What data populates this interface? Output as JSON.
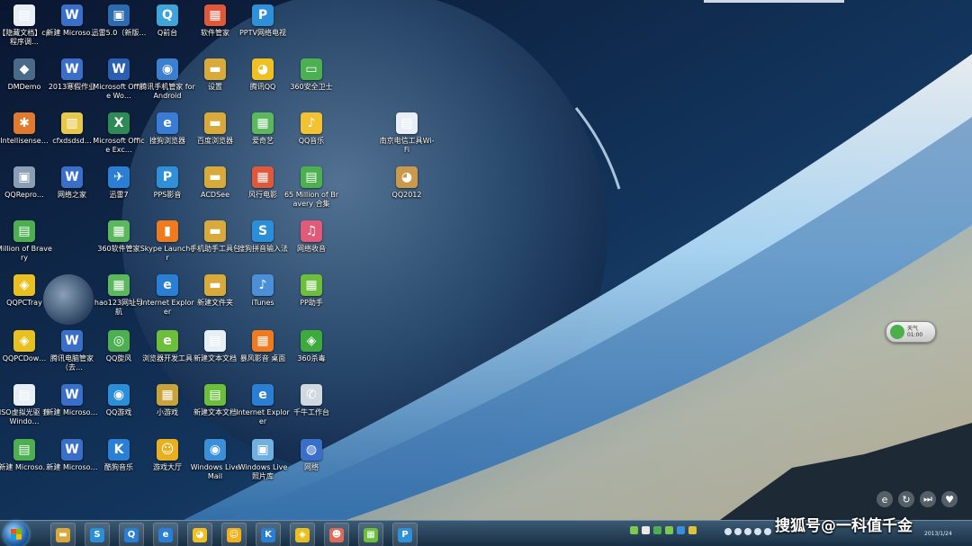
{
  "colors": {
    "taskbar": "#1f3a52",
    "label_text": "#ffffff"
  },
  "desktop": {
    "icons": [
      {
        "label": "【隐藏文档】cp程序调…",
        "icon": "document-icon",
        "color": "#e8eef5",
        "glyph": "▤"
      },
      {
        "label": "新建 Microso…",
        "icon": "document-icon",
        "color": "#3a6fc9",
        "glyph": "W"
      },
      {
        "label": "迅雷5.0（新版…",
        "icon": "browser-window-icon",
        "color": "#2b6cb0",
        "glyph": "▣"
      },
      {
        "label": "Q前台",
        "icon": "shortcut-icon",
        "color": "#3da5d9",
        "glyph": "Q"
      },
      {
        "label": "软件管家",
        "icon": "app-icon",
        "color": "#e0583a",
        "glyph": "▦"
      },
      {
        "label": "PPTV网络电视",
        "icon": "pptv-icon",
        "color": "#2f8fd8",
        "glyph": "P"
      },
      {
        "label": "DMDemo",
        "icon": "app-icon",
        "color": "#4a6a8a",
        "glyph": "◆"
      },
      {
        "label": "2013寒假作业",
        "icon": "document-icon",
        "color": "#3a6fc9",
        "glyph": "W"
      },
      {
        "label": "Microsoft Office Wo…",
        "icon": "word-icon",
        "color": "#2b5fb3",
        "glyph": "W"
      },
      {
        "label": "腾讯手机管家 for Android",
        "icon": "phone-manager-icon",
        "color": "#3b7fd0",
        "glyph": "◉"
      },
      {
        "label": "设置",
        "icon": "folder-icon",
        "color": "#d9a93a",
        "glyph": "▬"
      },
      {
        "label": "腾讯QQ",
        "icon": "qq-penguin-icon",
        "color": "#f0c020",
        "glyph": "◕"
      },
      {
        "label": "360安全卫士",
        "icon": "monitor-icon",
        "color": "#4caf50",
        "glyph": "▭"
      },
      {
        "label": "Intellisense…",
        "icon": "app-icon",
        "color": "#e07a2e",
        "glyph": "✱"
      },
      {
        "label": "cfxdsdsd…",
        "icon": "document-icon",
        "color": "#e8c84a",
        "glyph": "▥"
      },
      {
        "label": "Microsoft Office Exc…",
        "icon": "excel-icon",
        "color": "#2e8b57",
        "glyph": "X"
      },
      {
        "label": "搜狗浏览器",
        "icon": "browser-icon",
        "color": "#3a7bd5",
        "glyph": "e"
      },
      {
        "label": "百度浏览器",
        "icon": "folder-icon",
        "color": "#d9a93a",
        "glyph": "▬"
      },
      {
        "label": "爱奇艺",
        "icon": "app-icon",
        "color": "#5cb85c",
        "glyph": "▦"
      },
      {
        "label": "QQ音乐",
        "icon": "qq-music-icon",
        "color": "#f2c232",
        "glyph": "♪"
      },
      {
        "label": "南京电信工具Wi-Fi",
        "icon": "document-icon",
        "color": "#e8eef5",
        "glyph": "▤"
      },
      {
        "label": "QQRepro…",
        "icon": "app-icon",
        "color": "#8a9fb5",
        "glyph": "▣"
      },
      {
        "label": "网络之家",
        "icon": "document-icon",
        "color": "#3a6fc9",
        "glyph": "W"
      },
      {
        "label": "迅雷7",
        "icon": "thunder-icon",
        "color": "#2a7fd4",
        "glyph": "✈"
      },
      {
        "label": "PPS影音",
        "icon": "pps-icon",
        "color": "#2f8fd8",
        "glyph": "P"
      },
      {
        "label": "ACDSee",
        "icon": "folder-icon",
        "color": "#d9a93a",
        "glyph": "▬"
      },
      {
        "label": "风行电影",
        "icon": "app-icon",
        "color": "#e0583a",
        "glyph": "▦"
      },
      {
        "label": "65 Million of Bravery 合集",
        "icon": "document-icon",
        "color": "#4caf50",
        "glyph": "▤"
      },
      {
        "label": "QQ2012",
        "icon": "qq-icon",
        "color": "#c99a4a",
        "glyph": "◕"
      },
      {
        "label": "Million of Bravery",
        "icon": "document-icon",
        "color": "#4caf50",
        "glyph": "▤"
      },
      {
        "label": "360软件管家",
        "icon": "app-icon",
        "color": "#5cb85c",
        "glyph": "▦"
      },
      {
        "label": "Skype Launcher",
        "icon": "app-icon",
        "color": "#f07a1e",
        "glyph": "▮"
      },
      {
        "label": "手机助手工具包",
        "icon": "folder-icon",
        "color": "#d9a93a",
        "glyph": "▬"
      },
      {
        "label": "搜狗拼音输入法",
        "icon": "sogou-icon",
        "color": "#2a8fd8",
        "glyph": "S"
      },
      {
        "label": "网络收音",
        "icon": "radio-icon",
        "color": "#e05a7a",
        "glyph": "♫"
      },
      {
        "label": "QQPCTray",
        "icon": "shield-icon",
        "color": "#e8c020",
        "glyph": "◈"
      },
      {
        "label": "hao123网址导航",
        "icon": "app-icon",
        "color": "#5cb85c",
        "glyph": "▦"
      },
      {
        "label": "Internet Explorer",
        "icon": "ie-icon",
        "color": "#2a7fd4",
        "glyph": "e"
      },
      {
        "label": "新建文件夹",
        "icon": "folder-icon",
        "color": "#d9a93a",
        "glyph": "▬"
      },
      {
        "label": "iTunes",
        "icon": "itunes-icon",
        "color": "#4a8fd8",
        "glyph": "♪"
      },
      {
        "label": "PP助手",
        "icon": "app-icon",
        "color": "#6cbf3a",
        "glyph": "▦"
      },
      {
        "label": "QQPCDow…",
        "icon": "shield-icon",
        "color": "#e8c020",
        "glyph": "◈"
      },
      {
        "label": "腾讯电脑管家（去…",
        "icon": "document-icon",
        "color": "#3a6fc9",
        "glyph": "W"
      },
      {
        "label": "QQ旋风",
        "icon": "qq-tornado-icon",
        "color": "#4caf50",
        "glyph": "◎"
      },
      {
        "label": "浏览器开发工具",
        "icon": "browser-icon",
        "color": "#6cbf3a",
        "glyph": "e"
      },
      {
        "label": "新建文本文档",
        "icon": "document-icon",
        "color": "#e8eef5",
        "glyph": "▤"
      },
      {
        "label": "暴风影音 桌面",
        "icon": "app-icon",
        "color": "#f07a1e",
        "glyph": "▦"
      },
      {
        "label": "360杀毒",
        "icon": "shield-icon",
        "color": "#3caa3c",
        "glyph": "◈"
      },
      {
        "label": "ISO虚拟光驱 套 Windo…",
        "icon": "document-icon",
        "color": "#e8eef5",
        "glyph": "▤"
      },
      {
        "label": "新建 Microso…",
        "icon": "document-icon",
        "color": "#3a6fc9",
        "glyph": "W"
      },
      {
        "label": "QQ游戏",
        "icon": "qq-game-icon",
        "color": "#2a8fd8",
        "glyph": "◉"
      },
      {
        "label": "小游戏",
        "icon": "game-icon",
        "color": "#c9a23a",
        "glyph": "▦"
      },
      {
        "label": "新建文本文档",
        "icon": "document-icon",
        "color": "#6cbf3a",
        "glyph": "▤"
      },
      {
        "label": "Internet Explorer",
        "icon": "ie-icon",
        "color": "#2a7fd4",
        "glyph": "e"
      },
      {
        "label": "千牛工作台",
        "icon": "phone-icon",
        "color": "#d0d8e0",
        "glyph": "✆"
      },
      {
        "label": "新建 Microso…",
        "icon": "picture-icon",
        "color": "#4caf50",
        "glyph": "▤"
      },
      {
        "label": "新建 Microso…",
        "icon": "document-icon",
        "color": "#3a6fc9",
        "glyph": "W"
      },
      {
        "label": "酷狗音乐",
        "icon": "kugou-icon",
        "color": "#2a7fd4",
        "glyph": "K"
      },
      {
        "label": "游戏大厅",
        "icon": "game-icon",
        "color": "#e8b020",
        "glyph": "☺"
      },
      {
        "label": "Windows Live Mail",
        "icon": "globe-icon",
        "color": "#3a8fd8",
        "glyph": "◉"
      },
      {
        "label": "Windows Live 照片库",
        "icon": "photo-gallery-icon",
        "color": "#6fb0e0",
        "glyph": "▣"
      },
      {
        "label": "网络",
        "icon": "network-icon",
        "color": "#3a6fc9",
        "glyph": "◍"
      }
    ]
  },
  "gadget": {
    "text": "天气 01:00"
  },
  "side_controls": [
    "e",
    "↻",
    "⏭",
    "♥"
  ],
  "taskbar": {
    "items": [
      {
        "icon": "folder-icon",
        "color": "#d9a93a",
        "glyph": "▬"
      },
      {
        "icon": "sogou-icon",
        "color": "#2a8fd8",
        "glyph": "S"
      },
      {
        "icon": "qq-browser-icon",
        "color": "#2a7fd4",
        "glyph": "Q"
      },
      {
        "icon": "ie-icon",
        "color": "#2a7fd4",
        "glyph": "e"
      },
      {
        "icon": "qq-penguin-icon",
        "color": "#f0c020",
        "glyph": "◕"
      },
      {
        "icon": "smiley-icon",
        "color": "#f2b21e",
        "glyph": "☺"
      },
      {
        "icon": "kugou-icon",
        "color": "#2a7fd4",
        "glyph": "K"
      },
      {
        "icon": "shield-icon",
        "color": "#e8c020",
        "glyph": "◈"
      },
      {
        "icon": "contacts-icon",
        "color": "#e06a5a",
        "glyph": "☻"
      },
      {
        "icon": "green-app-icon",
        "color": "#6cbf3a",
        "glyph": "▦"
      },
      {
        "icon": "pptv-icon",
        "color": "#2f8fd8",
        "glyph": "P"
      }
    ],
    "tray_colors": [
      "#7ec850",
      "#e8e8e8",
      "#4caf50",
      "#7ec850",
      "#3a8fd8",
      "#e0c040"
    ],
    "clock": "2013/1/24"
  },
  "watermark": "搜狐号@一科值千金"
}
